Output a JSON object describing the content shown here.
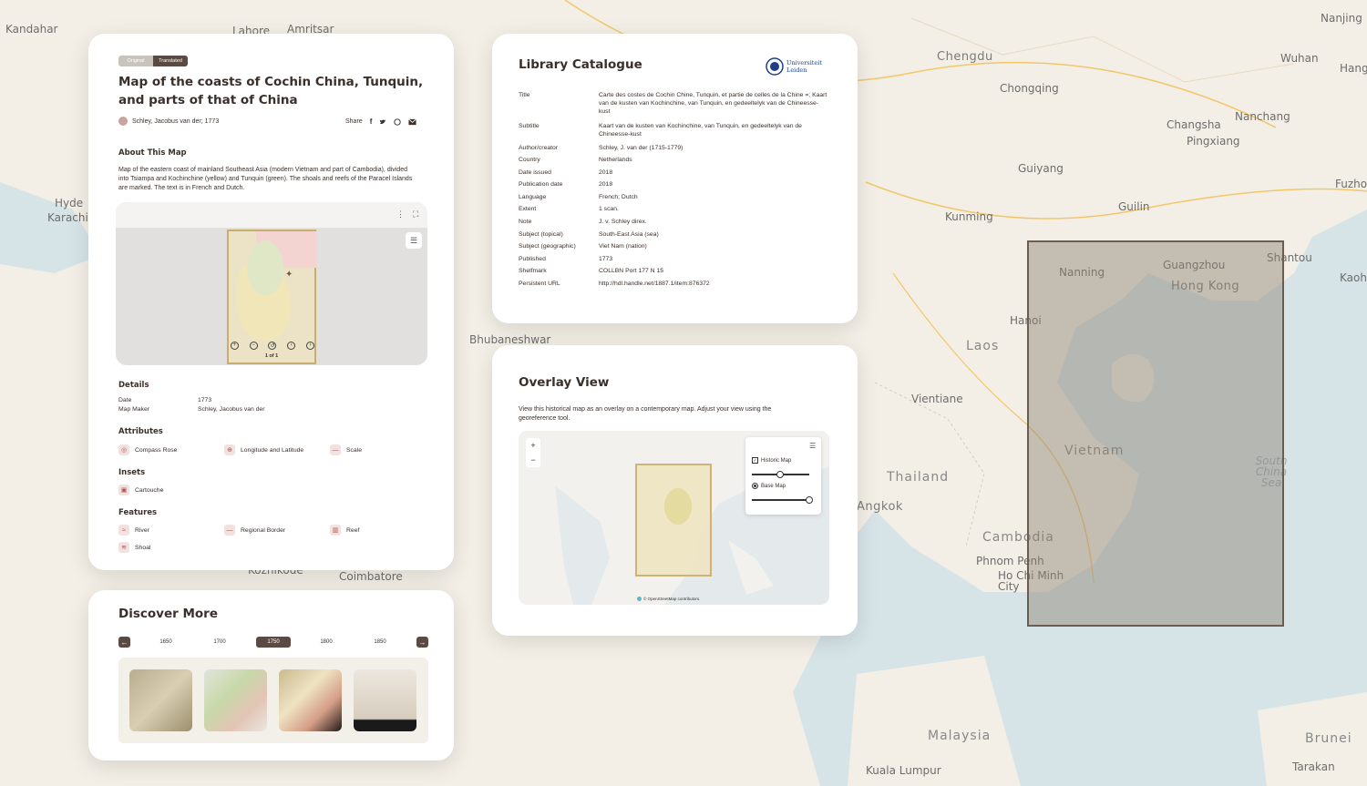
{
  "background_map": {
    "labels": [
      "Kandahar",
      "Lahore",
      "Amritsar",
      "Chengdu",
      "Wuhan",
      "Nanjing",
      "Chongqing",
      "Hang",
      "Changsha",
      "Nanchang",
      "Pingxiang",
      "Fuzho",
      "Guiyang",
      "Kunming",
      "Guilin",
      "Nanning",
      "Guangzhou",
      "Shantou",
      "Hong Kong",
      "Kaoh",
      "Hyde",
      "Karachi",
      "Bhubaneshwar",
      "Hanoi",
      "Laos",
      "Vientiane",
      "Vietnam",
      "Thailand",
      "Angkok",
      "Cambodia",
      "Phnom Penh",
      "Ho Chi Minh City",
      "Coimbatore",
      "Kozhikode",
      "Malaysia",
      "Brunei",
      "Kuala Lumpur",
      "Tarakan",
      "South China Sea"
    ]
  },
  "detail_card": {
    "toggle_original": "Original",
    "toggle_translated": "Translated",
    "title": "Map of the coasts of Cochin China, Tunquin, and parts of that of China",
    "author_line": "Schley, Jacobus van der; 1773",
    "share_label": "Share",
    "about_heading": "About This Map",
    "about_text": "Map of the eastern coast of mainland Southeast Asia (modern Vietnam and part of Cambodia), divided into Tsiampa and Kochinchine (yellow) and Tunquin (green). The shoals and reefs of the Paracel Islands are marked. The text is in French and Dutch.",
    "viewer_page": "1 of 1",
    "details_heading": "Details",
    "details": [
      {
        "k": "Date",
        "v": "1773"
      },
      {
        "k": "Map Maker",
        "v": "Schley, Jacobus van der"
      }
    ],
    "attributes_heading": "Attributes",
    "attributes": [
      "Compass Rose",
      "Longitude and Latitude",
      "Scale"
    ],
    "insets_heading": "Insets",
    "insets": [
      "Cartouche"
    ],
    "features_heading": "Features",
    "features": [
      "River",
      "Regional Border",
      "Reef",
      "Shoal"
    ]
  },
  "discover_card": {
    "title": "Discover More",
    "decades": [
      "1650",
      "1700",
      "1750",
      "1800",
      "1850"
    ],
    "active_decade": "1750"
  },
  "catalogue_card": {
    "title": "Library Catalogue",
    "logo_text_1": "Universiteit",
    "logo_text_2": "Leiden",
    "rows": [
      {
        "k": "Title",
        "v": "Carte des costes de Cochin Chine, Tunquin, et partie de celles de la Chine =; Kaart van de kusten van Kochinchine, van Tunquin, en gedeeltelyk van de Chineesse-kust"
      },
      {
        "k": "Subtitle",
        "v": "Kaart van de kusten van Kochinchine, van Tunquin, en gedeeltelyk van de Chineesse-kust"
      },
      {
        "k": "Author/creator",
        "v": "Schley, J. van der (1715-1779)"
      },
      {
        "k": "Country",
        "v": "Netherlands"
      },
      {
        "k": "Date issued",
        "v": "2018"
      },
      {
        "k": "Publication date",
        "v": "2018"
      },
      {
        "k": "Language",
        "v": "French; Dutch"
      },
      {
        "k": "Extent",
        "v": "1 scan."
      },
      {
        "k": "Note",
        "v": "J. v. Schley direx."
      },
      {
        "k": "Subject (topical)",
        "v": "South-East Asia (sea)"
      },
      {
        "k": "Subject (geographic)",
        "v": "Viet Nam (nation)"
      },
      {
        "k": "Published",
        "v": "1773"
      },
      {
        "k": "Shelfmark",
        "v": "COLLBN Port 177 N 15"
      },
      {
        "k": "Persistent URL",
        "v": "http://hdl.handle.net/1887.1/item:876372"
      }
    ]
  },
  "overlay_card": {
    "title": "Overlay View",
    "text": "View this historical map as an overlay on a contemporary map. Adjust your view using the georeference tool.",
    "zoom_in": "+",
    "zoom_out": "−",
    "historic_label": "Historic Map",
    "base_label": "Base Map",
    "historic_opacity": 0.47,
    "base_opacity": 1.0,
    "attribution": "© OpenStreetMap contributors."
  }
}
